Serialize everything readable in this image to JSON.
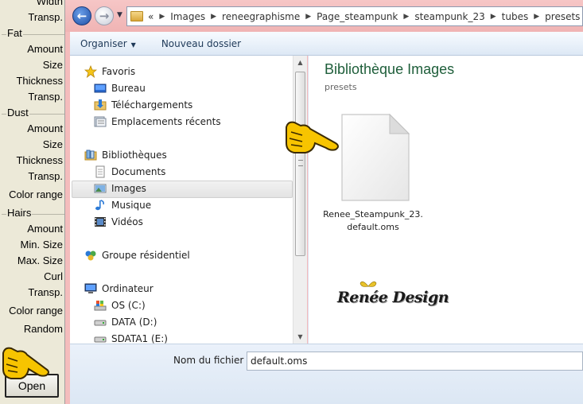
{
  "left_panel": {
    "rows": [
      {
        "text": "Width",
        "kind": "label"
      },
      {
        "text": "Transp.",
        "kind": "label"
      },
      {
        "text": "Fat",
        "kind": "section"
      },
      {
        "text": "Amount",
        "kind": "label"
      },
      {
        "text": "Size",
        "kind": "label"
      },
      {
        "text": "Thickness",
        "kind": "label"
      },
      {
        "text": "Transp.",
        "kind": "label"
      },
      {
        "text": "Dust",
        "kind": "section"
      },
      {
        "text": "Amount",
        "kind": "label"
      },
      {
        "text": "Size",
        "kind": "label"
      },
      {
        "text": "Thickness",
        "kind": "label"
      },
      {
        "text": "Transp.",
        "kind": "label"
      },
      {
        "text": "Color range",
        "kind": "label"
      },
      {
        "text": "Hairs",
        "kind": "section"
      },
      {
        "text": "Amount",
        "kind": "label"
      },
      {
        "text": "Min. Size",
        "kind": "label"
      },
      {
        "text": "Max. Size",
        "kind": "label"
      },
      {
        "text": "Curl",
        "kind": "label"
      },
      {
        "text": "Transp.",
        "kind": "label"
      },
      {
        "text": "Color range",
        "kind": "label"
      },
      {
        "text": "Random",
        "kind": "label"
      }
    ],
    "open_label": "Open"
  },
  "addressbar": {
    "overflow": "«",
    "crumbs": [
      "Images",
      "reneegraphisme",
      "Page_steampunk",
      "steampunk_23",
      "tubes",
      "presets"
    ]
  },
  "toolbar": {
    "organize_label": "Organiser",
    "new_folder_label": "Nouveau dossier"
  },
  "nav": {
    "favorites": "Favoris",
    "desktop": "Bureau",
    "downloads": "Téléchargements",
    "recent": "Emplacements récents",
    "libraries": "Bibliothèques",
    "documents": "Documents",
    "images": "Images",
    "music": "Musique",
    "videos": "Vidéos",
    "homegroup": "Groupe résidentiel",
    "computer": "Ordinateur",
    "drive_c": "OS (C:)",
    "drive_d": "DATA (D:)",
    "drive_e": "SDATA1 (E:)"
  },
  "content": {
    "title": "Bibliothèque Images",
    "subtitle": "presets",
    "file_name": "Renee_Steampunk_23.default.oms",
    "watermark": "Renée Design"
  },
  "footer": {
    "filename_label": "Nom du fichier :",
    "filename_value": "default.oms"
  },
  "colors": {
    "library_title": "#1e5e3a",
    "window_frame": "#f4bcbc",
    "panel_bg": "#ece9d8"
  }
}
